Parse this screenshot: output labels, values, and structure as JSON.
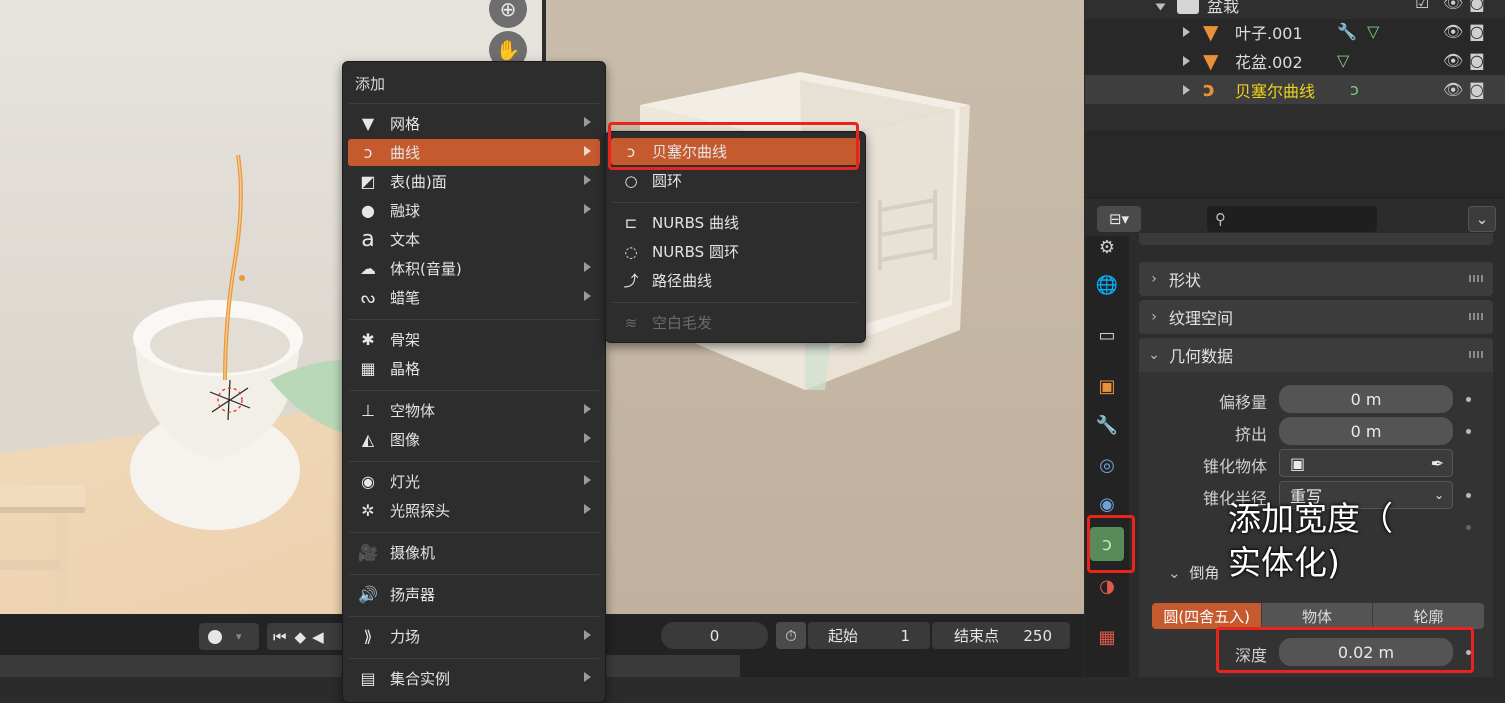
{
  "viewport": {
    "nav_icons": [
      "zoom-icon",
      "hand-icon"
    ]
  },
  "add_menu": {
    "title": "添加",
    "items": [
      {
        "label": "网格",
        "icon": "mesh-icon",
        "submenu": true
      },
      {
        "label": "曲线",
        "icon": "curve-icon",
        "submenu": true,
        "active": true
      },
      {
        "label": "表(曲)面",
        "icon": "surface-icon",
        "submenu": true
      },
      {
        "label": "融球",
        "icon": "metaball-icon",
        "submenu": true
      },
      {
        "label": "文本",
        "icon": "text-icon",
        "submenu": false
      },
      {
        "label": "体积(音量)",
        "icon": "volume-icon",
        "submenu": true
      },
      {
        "label": "蜡笔",
        "icon": "grease-pencil-icon",
        "submenu": true
      },
      {
        "label": "骨架",
        "icon": "armature-icon",
        "submenu": false
      },
      {
        "label": "晶格",
        "icon": "lattice-icon",
        "submenu": false
      },
      {
        "label": "空物体",
        "icon": "empty-icon",
        "submenu": true
      },
      {
        "label": "图像",
        "icon": "image-icon",
        "submenu": true
      },
      {
        "label": "灯光",
        "icon": "light-icon",
        "submenu": true
      },
      {
        "label": "光照探头",
        "icon": "light-probe-icon",
        "submenu": true
      },
      {
        "label": "摄像机",
        "icon": "camera-icon",
        "submenu": false
      },
      {
        "label": "扬声器",
        "icon": "speaker-icon",
        "submenu": false
      },
      {
        "label": "力场",
        "icon": "force-field-icon",
        "submenu": true
      },
      {
        "label": "集合实例",
        "icon": "collection-instance-icon",
        "submenu": true
      }
    ]
  },
  "curve_submenu": {
    "items": [
      {
        "label": "贝塞尔曲线",
        "icon": "bezier-curve-icon",
        "active": true
      },
      {
        "label": "圆环",
        "icon": "bezier-circle-icon"
      },
      {
        "label": "NURBS 曲线",
        "icon": "nurbs-curve-icon"
      },
      {
        "label": "NURBS 圆环",
        "icon": "nurbs-circle-icon"
      },
      {
        "label": "路径曲线",
        "icon": "path-curve-icon"
      },
      {
        "label": "空白毛发",
        "icon": "empty-hair-icon",
        "disabled": true
      }
    ]
  },
  "timeline": {
    "current_frame": "0",
    "start_label": "起始",
    "start_value": "1",
    "end_label": "结束点",
    "end_value": "250"
  },
  "outliner": {
    "rows": [
      {
        "label": "盆栽",
        "type": "collection"
      },
      {
        "label": "叶子.001",
        "type": "mesh"
      },
      {
        "label": "花盆.002",
        "type": "mesh"
      },
      {
        "label": "贝塞尔曲线",
        "type": "curve",
        "selected": true
      }
    ]
  },
  "properties": {
    "panels": {
      "shape": "形状",
      "texture_space": "纹理空间",
      "geometry": "几何数据",
      "bevel": "倒角"
    },
    "geometry": {
      "offset_label": "偏移量",
      "offset_value": "0 m",
      "extrude_label": "挤出",
      "extrude_value": "0 m",
      "taper_label": "锥化物体",
      "taper_radius_label": "锥化半径",
      "taper_radius_value": "重写"
    },
    "bevel": {
      "modes": [
        "圆(四舍五入)",
        "物体",
        "轮廓"
      ],
      "active_mode": "圆(四舍五入)",
      "depth_label": "深度",
      "depth_value": "0.02 m"
    }
  },
  "annotation": {
    "line1": "添加宽度（",
    "line2": "实体化)"
  },
  "colors": {
    "accent": "#c55a2f",
    "highlight_box": "#e8241c",
    "selected_text": "#f2d21b"
  }
}
